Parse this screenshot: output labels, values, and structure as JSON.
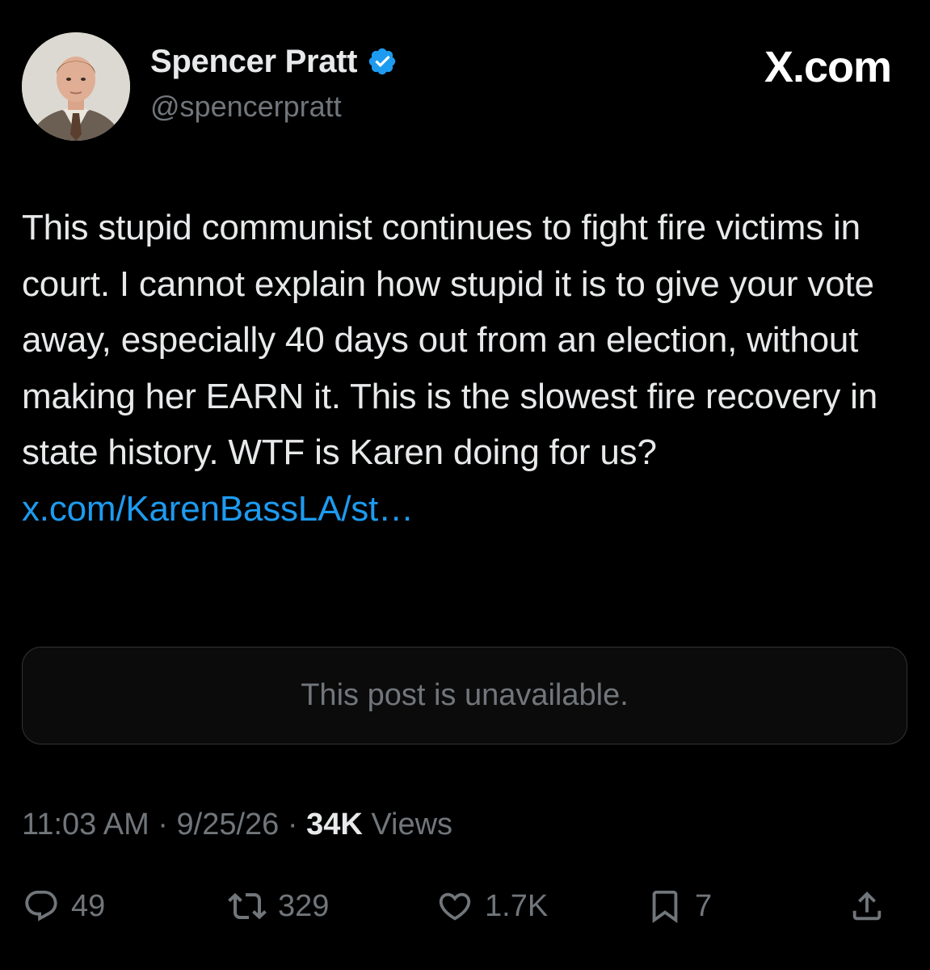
{
  "header": {
    "display_name": "Spencer Pratt",
    "handle": "@spencerpratt",
    "brand": "X.com",
    "avatar_icon": "profile-photo",
    "verified_icon": "verified-badge-icon",
    "verified_color": "#1d9bf0"
  },
  "post": {
    "text": "This stupid communist continues to fight fire victims in court. I cannot explain how stupid it is to give your vote away, especially 40 days out from an election, without making her EARN it. This is the slowest fire recovery in state history. WTF is Karen doing for us? ",
    "link_text": "x.com/KarenBassLA/st…",
    "link_color": "#1d9bf0"
  },
  "quoted": {
    "message": "This post is unavailable."
  },
  "meta": {
    "time": "11:03 AM",
    "separator": " · ",
    "date": "9/25/26",
    "views_count": "34K",
    "views_label": " Views"
  },
  "actions": {
    "replies": "49",
    "reposts": "329",
    "likes": "1.7K",
    "bookmarks": "7",
    "icons": [
      "reply-icon",
      "repost-icon",
      "like-icon",
      "bookmark-icon",
      "share-icon"
    ]
  },
  "colors": {
    "background": "#000000",
    "text_primary": "#e7e9ea",
    "text_secondary": "#71767b",
    "accent": "#1d9bf0",
    "border": "#2f3336"
  }
}
